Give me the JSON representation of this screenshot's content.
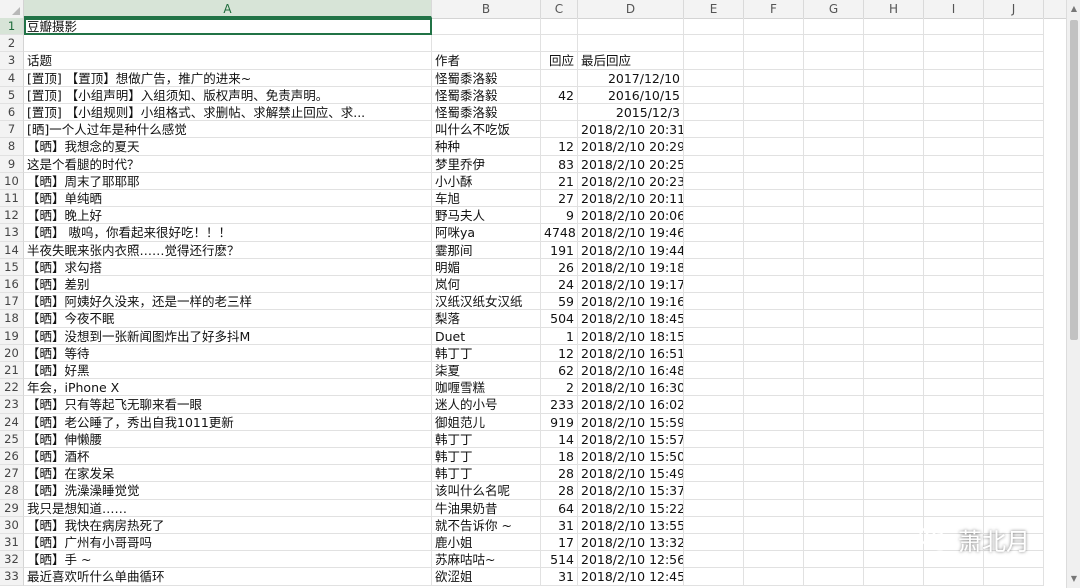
{
  "columns": [
    "A",
    "B",
    "C",
    "D",
    "E",
    "F",
    "G",
    "H",
    "I",
    "J"
  ],
  "selected_column": "A",
  "rows": [
    {
      "n": "1",
      "a": "豆瓣摄影",
      "b": "",
      "c": "",
      "d": ""
    },
    {
      "n": "2",
      "a": "",
      "b": "",
      "c": "",
      "d": ""
    },
    {
      "n": "3",
      "a": "话题",
      "b": "作者",
      "c": "回应",
      "d": "最后回应",
      "dleft": true
    },
    {
      "n": "4",
      "a": "[置顶] 【置顶】想做广告，推广的进来~",
      "b": "怪蜀黍洛毅",
      "c": "",
      "d": "2017/12/10"
    },
    {
      "n": "5",
      "a": "[置顶] 【小组声明】入组须知、版权声明、免责声明。",
      "b": "怪蜀黍洛毅",
      "c": "42",
      "d": "2016/10/15"
    },
    {
      "n": "6",
      "a": "[置顶] 【小组规则】小组格式、求删帖、求解禁止回应、求...",
      "b": "怪蜀黍洛毅",
      "c": "",
      "d": "2015/12/3"
    },
    {
      "n": "7",
      "a": "[晒]一个人过年是种什么感觉",
      "b": "叫什么不吃饭",
      "c": "",
      "d": "2018/2/10 20:31"
    },
    {
      "n": "8",
      "a": "【晒】我想念的夏天",
      "b": "种种",
      "c": "12",
      "d": "2018/2/10 20:29"
    },
    {
      "n": "9",
      "a": "这是个看腿的时代？",
      "b": "梦里乔伊",
      "c": "83",
      "d": "2018/2/10 20:25"
    },
    {
      "n": "10",
      "a": "【晒】周末了耶耶耶",
      "b": "小小酥",
      "c": "21",
      "d": "2018/2/10 20:23"
    },
    {
      "n": "11",
      "a": "【晒】单纯晒",
      "b": "车旭",
      "c": "27",
      "d": "2018/2/10 20:11"
    },
    {
      "n": "12",
      "a": "【晒】晚上好",
      "b": "野马夫人",
      "c": "9",
      "d": "2018/2/10 20:06"
    },
    {
      "n": "13",
      "a": "【晒】 嗷呜，你看起来很好吃！！！",
      "b": "阿咪ya",
      "c": "4748",
      "d": "2018/2/10 19:46"
    },
    {
      "n": "14",
      "a": "半夜失眠来张内衣照……觉得还行麽？",
      "b": "霎那间",
      "c": "191",
      "d": "2018/2/10 19:44"
    },
    {
      "n": "15",
      "a": "【晒】求勾搭",
      "b": "明媚",
      "c": "26",
      "d": "2018/2/10 19:18"
    },
    {
      "n": "16",
      "a": "【晒】差别",
      "b": "岚何",
      "c": "24",
      "d": "2018/2/10 19:17"
    },
    {
      "n": "17",
      "a": "【晒】阿姨好久没来，还是一样的老三样",
      "b": "汉纸汉纸女汉纸",
      "c": "59",
      "d": "2018/2/10 19:16"
    },
    {
      "n": "18",
      "a": "【晒】今夜不眠",
      "b": "梨落",
      "c": "504",
      "d": "2018/2/10 18:45"
    },
    {
      "n": "19",
      "a": "【晒】没想到一张新闻图炸出了好多抖M",
      "b": "Duet",
      "c": "1",
      "d": "2018/2/10 18:15"
    },
    {
      "n": "20",
      "a": "【晒】等待",
      "b": "韩丁丁",
      "c": "12",
      "d": "2018/2/10 16:51"
    },
    {
      "n": "21",
      "a": "【晒】好黑",
      "b": "柒夏",
      "c": "62",
      "d": "2018/2/10 16:48"
    },
    {
      "n": "22",
      "a": "年会，iPhone X",
      "b": "咖喱雪糕",
      "c": "2",
      "d": "2018/2/10 16:30"
    },
    {
      "n": "23",
      "a": "【晒】只有等起飞无聊来看一眼",
      "b": "迷人的小号",
      "c": "233",
      "d": "2018/2/10 16:02"
    },
    {
      "n": "24",
      "a": "【晒】老公睡了，秀出自我1011更新",
      "b": "御姐范儿",
      "c": "919",
      "d": "2018/2/10 15:59"
    },
    {
      "n": "25",
      "a": "【晒】伸懒腰",
      "b": "韩丁丁",
      "c": "14",
      "d": "2018/2/10 15:57"
    },
    {
      "n": "26",
      "a": "【晒】酒杯",
      "b": "韩丁丁",
      "c": "18",
      "d": "2018/2/10 15:50"
    },
    {
      "n": "27",
      "a": "【晒】在家发呆",
      "b": "韩丁丁",
      "c": "28",
      "d": "2018/2/10 15:49"
    },
    {
      "n": "28",
      "a": "【晒】洗澡澡睡觉觉",
      "b": "该叫什么名呢",
      "c": "28",
      "d": "2018/2/10 15:37"
    },
    {
      "n": "29",
      "a": "我只是想知道……",
      "b": "牛油果奶昔",
      "c": "64",
      "d": "2018/2/10 15:22"
    },
    {
      "n": "30",
      "a": "【晒】我快在病房热死了",
      "b": "就不告诉你 ~",
      "c": "31",
      "d": "2018/2/10 13:55"
    },
    {
      "n": "31",
      "a": "【晒】广州有小哥哥吗",
      "b": "鹿小姐",
      "c": "17",
      "d": "2018/2/10 13:32"
    },
    {
      "n": "32",
      "a": "【晒】手 ~",
      "b": "苏麻咕咕~",
      "c": "514",
      "d": "2018/2/10 12:56"
    },
    {
      "n": "33",
      "a": "最近喜欢听什么单曲循环",
      "b": "欲涩姐",
      "c": "31",
      "d": "2018/2/10 12:45"
    }
  ],
  "watermark": {
    "text": "萧北月",
    "icon": "wechat-icon"
  },
  "colors": {
    "accent": "#217346",
    "grid": "#e1e1e1",
    "header_bg": "#f3f3f3"
  }
}
